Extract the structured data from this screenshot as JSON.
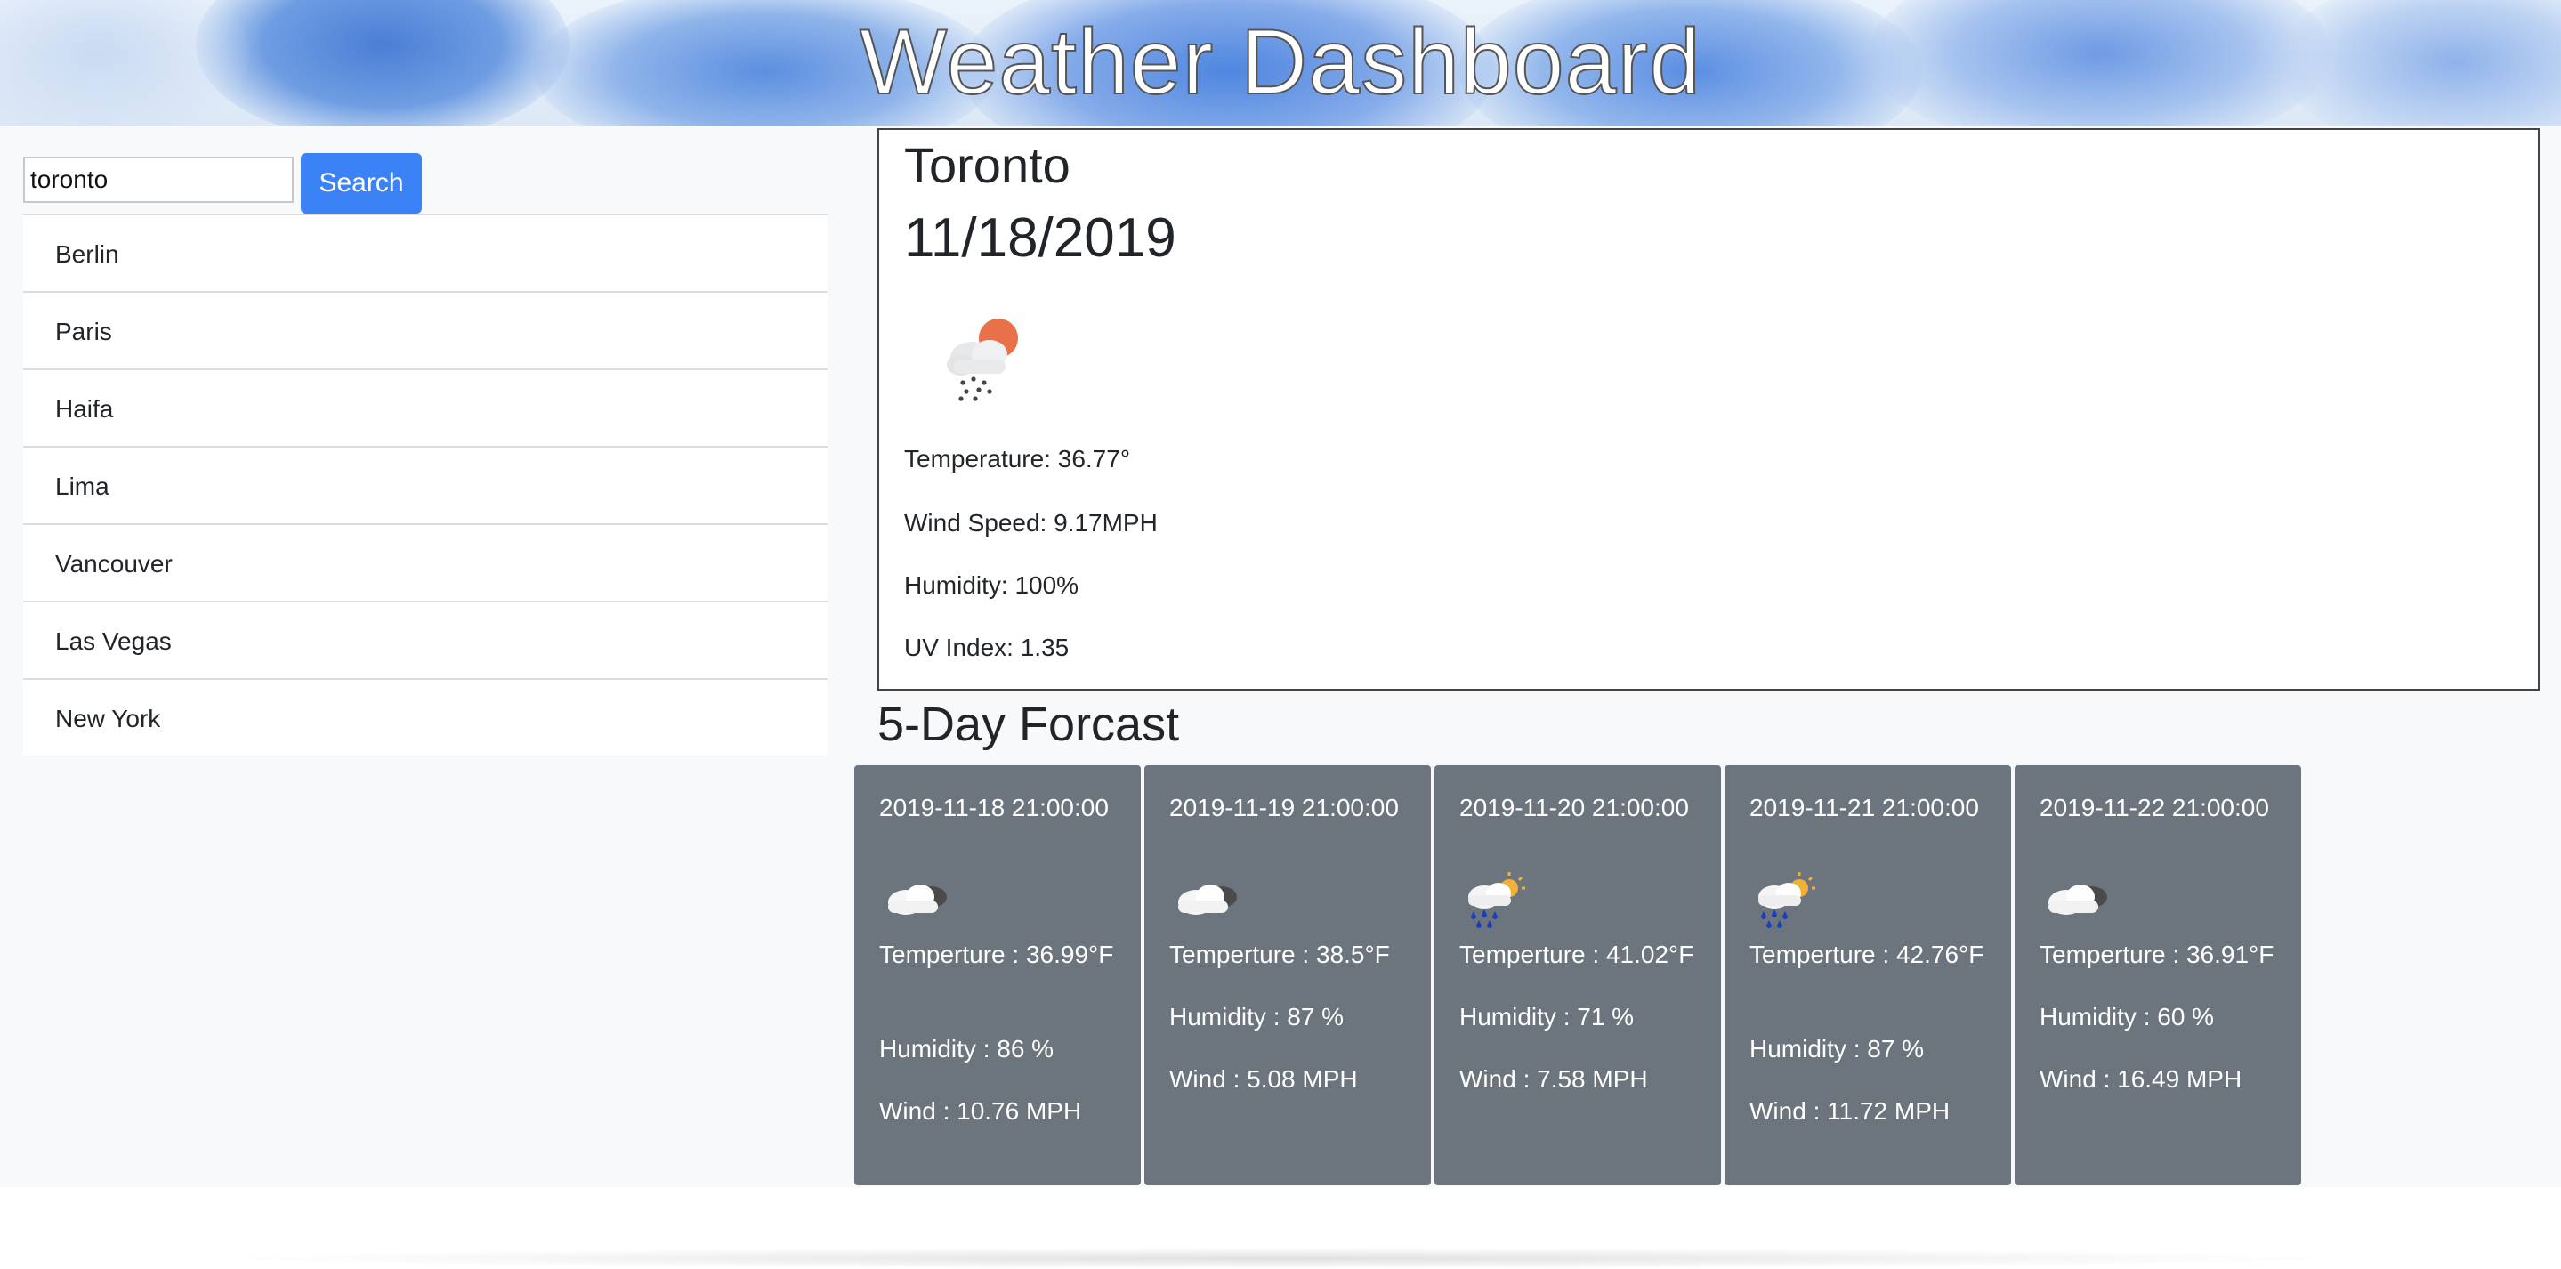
{
  "header": {
    "title": "Weather Dashboard"
  },
  "sidebar": {
    "search_value": "toronto",
    "search_button_label": "Search",
    "cities": [
      "Berlin",
      "Paris",
      "Haifa",
      "Lima",
      "Vancouver",
      "Las Vegas",
      "New York"
    ]
  },
  "current": {
    "city": "Toronto",
    "date": "11/18/2019",
    "icon": "rain-sun-cloud-icon",
    "temperature": "Temperature: 36.77°",
    "wind": "Wind Speed: 9.17MPH",
    "humidity": "Humidity: 100%",
    "uv": "UV Index: 1.35"
  },
  "forecast": {
    "title": "5-Day Forcast",
    "days": [
      {
        "date": "2019-11-18 21:00:00",
        "icon": "cloud-icon",
        "temp": "Temperture : 36.99°F",
        "humidity": "Humidity : 86 %",
        "wind": "Wind : 10.76 MPH"
      },
      {
        "date": "2019-11-19 21:00:00",
        "icon": "cloud-icon",
        "temp": "Temperture : 38.5°F",
        "humidity": "Humidity : 87 %",
        "wind": "Wind : 5.08 MPH"
      },
      {
        "date": "2019-11-20 21:00:00",
        "icon": "rain-sun-icon",
        "temp": "Temperture : 41.02°F",
        "humidity": "Humidity : 71 %",
        "wind": "Wind : 7.58 MPH"
      },
      {
        "date": "2019-11-21 21:00:00",
        "icon": "rain-sun-icon",
        "temp": "Temperture : 42.76°F",
        "humidity": "Humidity : 87 %",
        "wind": "Wind : 11.72 MPH"
      },
      {
        "date": "2019-11-22 21:00:00",
        "icon": "cloud-icon",
        "temp": "Temperture : 36.91°F",
        "humidity": "Humidity : 60 %",
        "wind": "Wind : 16.49 MPH"
      }
    ]
  }
}
